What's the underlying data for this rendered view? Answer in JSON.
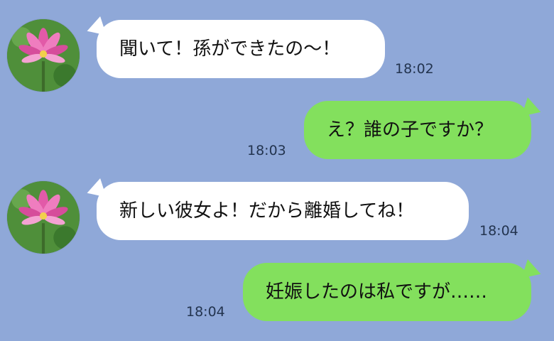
{
  "messages": [
    {
      "side": "in",
      "text": "聞いて！孫ができたの〜！",
      "time": "18:02"
    },
    {
      "side": "out",
      "text": "え？誰の子ですか？",
      "time": "18:03"
    },
    {
      "side": "in",
      "text": "新しい彼女よ！だから離婚してね！",
      "time": "18:04"
    },
    {
      "side": "out",
      "text": "妊娠したのは私ですが……",
      "time": "18:04"
    }
  ],
  "avatar": {
    "icon": "lotus-flower-icon"
  },
  "colors": {
    "background": "#8fa8d8",
    "incoming_bubble": "#ffffff",
    "outgoing_bubble": "#83e05d"
  }
}
